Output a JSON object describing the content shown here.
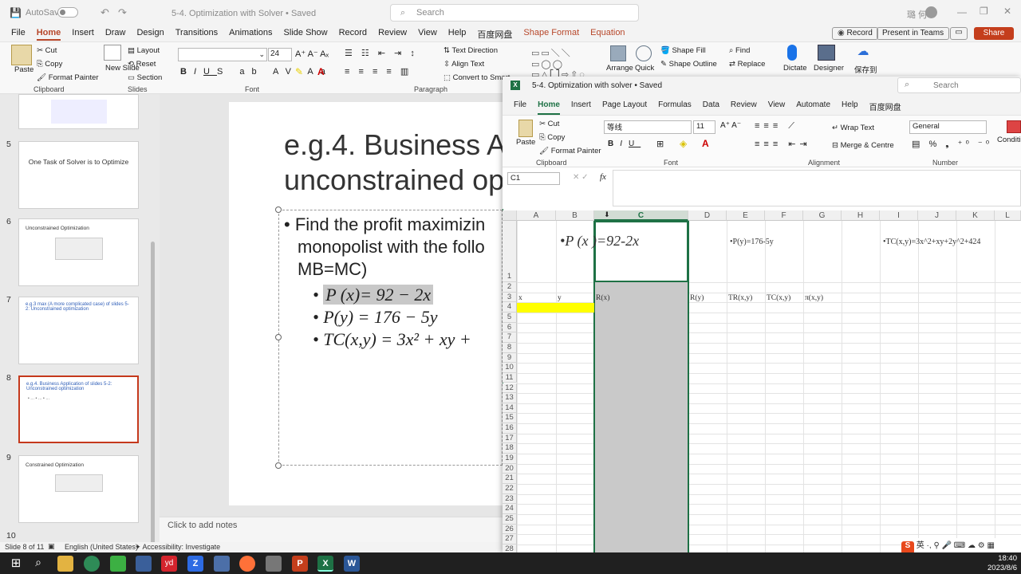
{
  "ppt": {
    "title_bar": {
      "autosave": "AutoSave",
      "autosave_state": "Off",
      "doc_title": "5-4. Optimization with Solver • Saved",
      "search_placeholder": "Search",
      "user": "璐 何"
    },
    "menu": [
      "File",
      "Home",
      "Insert",
      "Draw",
      "Design",
      "Transitions",
      "Animations",
      "Slide Show",
      "Record",
      "Review",
      "View",
      "Help",
      "百度网盘",
      "Shape Format",
      "Equation"
    ],
    "menu_active": "Home",
    "menu_right": {
      "record": "Record",
      "present": "Present in Teams",
      "share": "Share"
    },
    "ribbon": {
      "paste": "Paste",
      "cut": "Cut",
      "copy": "Copy",
      "format_painter": "Format Painter",
      "clipboard": "Clipboard",
      "new_slide": "New Slide",
      "layout": "Layout",
      "reset": "Reset",
      "section": "Section",
      "slides": "Slides",
      "font_size": "24",
      "font": "Font",
      "paragraph": "Paragraph",
      "text_direction": "Text Direction",
      "align_text": "Align Text",
      "convert": "Convert to Smart",
      "arrange": "Arrange",
      "quick": "Quick",
      "shape_fill": "Shape Fill",
      "shape_outline": "Shape Outline",
      "find": "Find",
      "replace": "Replace",
      "dictate": "Dictate",
      "designer": "Designer",
      "save_to": "保存到"
    },
    "thumbs": [
      {
        "num": "5",
        "title": "One Task of Solver is to Optimize"
      },
      {
        "num": "6",
        "title": "Unconstrained Optimization"
      },
      {
        "num": "7",
        "title": "e.g.3 max (A more complicated case) of slides 5-2: Unconstrained optimization"
      },
      {
        "num": "8",
        "title": "e.g.4. Business Application of slides 5-2: Unconstrained optimization"
      },
      {
        "num": "9",
        "title": "Constrained Optimization"
      },
      {
        "num": "10",
        "title": ""
      }
    ],
    "slide": {
      "title_line1": "e.g.4. Business A",
      "title_line2": "unconstrained op",
      "bullet1_l1": "Find the profit maximizin",
      "bullet1_l2": "monopolist with the follo",
      "bullet1_l3": "MB=MC)",
      "sub1": "P (x)= 92 − 2x",
      "sub2": "P(y) = 176 − 5y",
      "sub3": "TC(x,y) = 3x² + xy +"
    },
    "notes": "Click to add notes",
    "status": {
      "slide": "Slide 8 of 11",
      "lang": "English (United States)",
      "access": "Accessibility: Investigate"
    }
  },
  "excel": {
    "title": "5-4. Optimization with solver • Saved",
    "search": "Search",
    "menu": [
      "File",
      "Home",
      "Insert",
      "Page Layout",
      "Formulas",
      "Data",
      "Review",
      "View",
      "Automate",
      "Help",
      "百度网盘"
    ],
    "menu_active": "Home",
    "ribbon": {
      "paste": "Paste",
      "cut": "Cut",
      "copy": "Copy",
      "format_painter": "Format Painter",
      "clipboard": "Clipboard",
      "font_name": "等线",
      "font_size": "11",
      "font": "Font",
      "wrap": "Wrap Text",
      "merge": "Merge & Centre",
      "alignment": "Alignment",
      "number_format": "General",
      "number": "Number",
      "conditional": "Conditi Formatti"
    },
    "name_box": "C1",
    "fx": "fx",
    "columns": [
      "A",
      "B",
      "C",
      "D",
      "E",
      "F",
      "G",
      "H",
      "I",
      "J",
      "K",
      "L"
    ],
    "row1_texts": {
      "p_x": "P (x )=92-2x",
      "p_y": "P(y)=176-5y",
      "tc": "TC(x,y)=3x^2+xy+2y^2+424"
    },
    "headers": [
      "x",
      "y",
      "R(x)",
      "R(y)",
      "TR(x,y)",
      "TC(x,y)",
      "π(x,y)"
    ],
    "rows": [
      "1",
      "2",
      "3",
      "4",
      "5",
      "6",
      "7",
      "8",
      "9",
      "10",
      "11",
      "12",
      "13",
      "14",
      "15",
      "16",
      "17",
      "18",
      "19",
      "20",
      "21",
      "22",
      "23",
      "24",
      "25",
      "26",
      "27",
      "28"
    ]
  },
  "taskbar": {
    "time": "18:40",
    "date": "2023/8/6"
  }
}
